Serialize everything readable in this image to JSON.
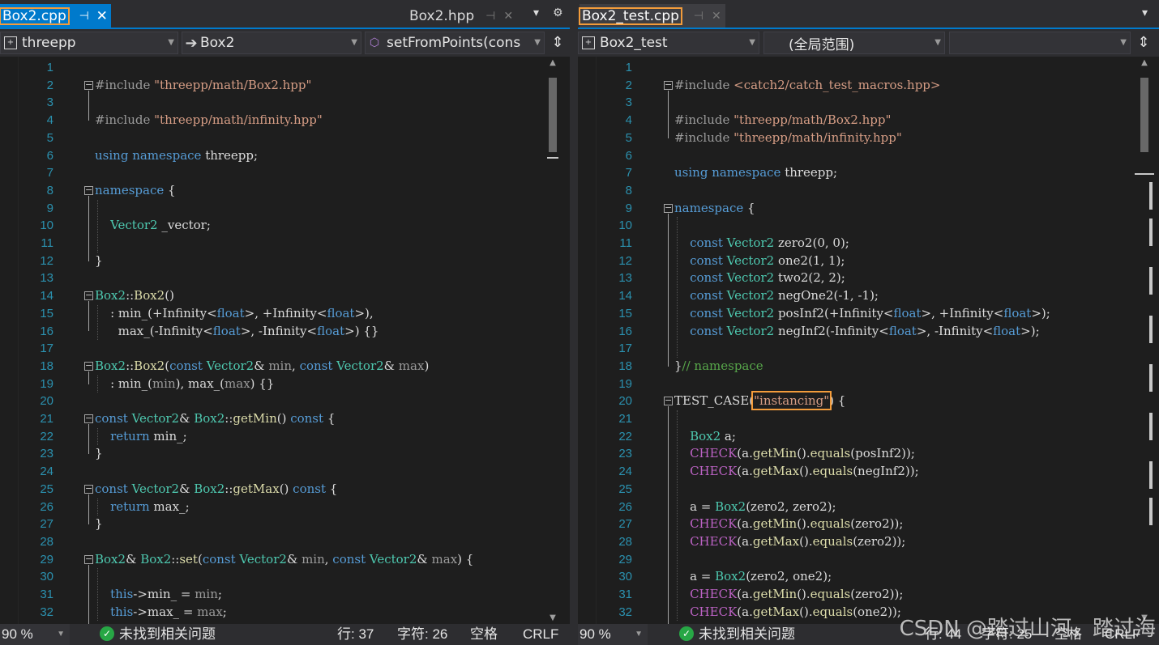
{
  "left": {
    "tabs": {
      "active_label": "Box2.cpp",
      "inactive_label": "Box2.hpp",
      "pin_glyph": "⊣",
      "close_glyph": "✕",
      "overflow_glyph": "▾",
      "settings_glyph": "⚙"
    },
    "nav": {
      "project": "threepp",
      "scope": "Box2",
      "member": "setFromPoints(cons"
    },
    "status": {
      "zoom": "90 %",
      "issues": "未找到相关问题",
      "line": "行: 37",
      "char": "字符: 26",
      "indent": "空格",
      "eol": "CRLF"
    }
  },
  "right": {
    "tabs": {
      "active_label": "Box2_test.cpp",
      "pin_glyph": "⊣",
      "close_glyph": "✕",
      "overflow_glyph": "▾"
    },
    "nav": {
      "project": "Box2_test",
      "scope": "(全局范围)",
      "member": ""
    },
    "status": {
      "zoom": "90 %",
      "issues": "未找到相关问题",
      "line": "行: 44",
      "char": "字符: 25",
      "indent": "空格",
      "eol": "CRLF"
    }
  },
  "left_code": [
    {
      "n": "1",
      "segs": []
    },
    {
      "n": "2",
      "segs": [
        [
          "pp",
          "#include "
        ],
        [
          "str",
          "\"threepp/math/Box2.hpp\""
        ]
      ]
    },
    {
      "n": "3",
      "segs": []
    },
    {
      "n": "4",
      "segs": [
        [
          "pp",
          "#include "
        ],
        [
          "str",
          "\"threepp/math/infinity.hpp\""
        ]
      ]
    },
    {
      "n": "5",
      "segs": []
    },
    {
      "n": "6",
      "segs": [
        [
          "kw",
          "using "
        ],
        [
          "kw",
          "namespace "
        ],
        [
          "txt",
          "threepp;"
        ]
      ]
    },
    {
      "n": "7",
      "segs": []
    },
    {
      "n": "8",
      "segs": [
        [
          "kw",
          "namespace "
        ],
        [
          "txt",
          "{"
        ]
      ]
    },
    {
      "n": "9",
      "segs": []
    },
    {
      "n": "10",
      "segs": [
        [
          "txt",
          "    "
        ],
        [
          "type",
          "Vector2 "
        ],
        [
          "txt",
          "_vector;"
        ]
      ]
    },
    {
      "n": "11",
      "segs": []
    },
    {
      "n": "12",
      "segs": [
        [
          "txt",
          "}"
        ]
      ]
    },
    {
      "n": "13",
      "segs": []
    },
    {
      "n": "14",
      "segs": [
        [
          "type",
          "Box2"
        ],
        [
          "txt",
          "::"
        ],
        [
          "fn",
          "Box2"
        ],
        [
          "txt",
          "()"
        ]
      ]
    },
    {
      "n": "15",
      "segs": [
        [
          "txt",
          "    : "
        ],
        [
          "mem",
          "min_"
        ],
        [
          "txt",
          "(+Infinity<"
        ],
        [
          "kw",
          "float"
        ],
        [
          "txt",
          ">, +Infinity<"
        ],
        [
          "kw",
          "float"
        ],
        [
          "txt",
          ">),"
        ]
      ]
    },
    {
      "n": "16",
      "segs": [
        [
          "txt",
          "      "
        ],
        [
          "mem",
          "max_"
        ],
        [
          "txt",
          "(-Infinity<"
        ],
        [
          "kw",
          "float"
        ],
        [
          "txt",
          ">, -Infinity<"
        ],
        [
          "kw",
          "float"
        ],
        [
          "txt",
          ">) {}"
        ]
      ]
    },
    {
      "n": "17",
      "segs": []
    },
    {
      "n": "18",
      "segs": [
        [
          "type",
          "Box2"
        ],
        [
          "txt",
          "::"
        ],
        [
          "fn",
          "Box2"
        ],
        [
          "txt",
          "("
        ],
        [
          "kw",
          "const "
        ],
        [
          "type",
          "Vector2"
        ],
        [
          "txt",
          "& "
        ],
        [
          "param",
          "min"
        ],
        [
          "txt",
          ", "
        ],
        [
          "kw",
          "const "
        ],
        [
          "type",
          "Vector2"
        ],
        [
          "txt",
          "& "
        ],
        [
          "param",
          "max"
        ],
        [
          "txt",
          ")"
        ]
      ]
    },
    {
      "n": "19",
      "segs": [
        [
          "txt",
          "    : "
        ],
        [
          "mem",
          "min_"
        ],
        [
          "txt",
          "("
        ],
        [
          "param",
          "min"
        ],
        [
          "txt",
          "), "
        ],
        [
          "mem",
          "max_"
        ],
        [
          "txt",
          "("
        ],
        [
          "param",
          "max"
        ],
        [
          "txt",
          ") {}"
        ]
      ]
    },
    {
      "n": "20",
      "segs": []
    },
    {
      "n": "21",
      "segs": [
        [
          "kw",
          "const "
        ],
        [
          "type",
          "Vector2"
        ],
        [
          "txt",
          "& "
        ],
        [
          "type",
          "Box2"
        ],
        [
          "txt",
          "::"
        ],
        [
          "fn",
          "getMin"
        ],
        [
          "txt",
          "() "
        ],
        [
          "kw",
          "const "
        ],
        [
          "txt",
          "{"
        ]
      ]
    },
    {
      "n": "22",
      "segs": [
        [
          "txt",
          "    "
        ],
        [
          "kw",
          "return "
        ],
        [
          "mem",
          "min_"
        ],
        [
          "txt",
          ";"
        ]
      ]
    },
    {
      "n": "23",
      "segs": [
        [
          "txt",
          "}"
        ]
      ]
    },
    {
      "n": "24",
      "segs": []
    },
    {
      "n": "25",
      "segs": [
        [
          "kw",
          "const "
        ],
        [
          "type",
          "Vector2"
        ],
        [
          "txt",
          "& "
        ],
        [
          "type",
          "Box2"
        ],
        [
          "txt",
          "::"
        ],
        [
          "fn",
          "getMax"
        ],
        [
          "txt",
          "() "
        ],
        [
          "kw",
          "const "
        ],
        [
          "txt",
          "{"
        ]
      ]
    },
    {
      "n": "26",
      "segs": [
        [
          "txt",
          "    "
        ],
        [
          "kw",
          "return "
        ],
        [
          "mem",
          "max_"
        ],
        [
          "txt",
          ";"
        ]
      ]
    },
    {
      "n": "27",
      "segs": [
        [
          "txt",
          "}"
        ]
      ]
    },
    {
      "n": "28",
      "segs": []
    },
    {
      "n": "29",
      "segs": [
        [
          "type",
          "Box2"
        ],
        [
          "txt",
          "& "
        ],
        [
          "type",
          "Box2"
        ],
        [
          "txt",
          "::"
        ],
        [
          "fn",
          "set"
        ],
        [
          "txt",
          "("
        ],
        [
          "kw",
          "const "
        ],
        [
          "type",
          "Vector2"
        ],
        [
          "txt",
          "& "
        ],
        [
          "param",
          "min"
        ],
        [
          "txt",
          ", "
        ],
        [
          "kw",
          "const "
        ],
        [
          "type",
          "Vector2"
        ],
        [
          "txt",
          "& "
        ],
        [
          "param",
          "max"
        ],
        [
          "txt",
          ") {"
        ]
      ]
    },
    {
      "n": "30",
      "segs": []
    },
    {
      "n": "31",
      "segs": [
        [
          "txt",
          "    "
        ],
        [
          "kw",
          "this"
        ],
        [
          "txt",
          "->"
        ],
        [
          "mem",
          "min_"
        ],
        [
          "txt",
          " = "
        ],
        [
          "param",
          "min"
        ],
        [
          "txt",
          ";"
        ]
      ]
    },
    {
      "n": "32",
      "segs": [
        [
          "txt",
          "    "
        ],
        [
          "kw",
          "this"
        ],
        [
          "txt",
          "->"
        ],
        [
          "mem",
          "max_"
        ],
        [
          "txt",
          " = "
        ],
        [
          "param",
          "max"
        ],
        [
          "txt",
          ";"
        ]
      ]
    }
  ],
  "right_code": [
    {
      "n": "1",
      "segs": []
    },
    {
      "n": "2",
      "segs": [
        [
          "pp",
          "#include "
        ],
        [
          "str",
          "<catch2/catch_test_macros.hpp>"
        ]
      ]
    },
    {
      "n": "3",
      "segs": []
    },
    {
      "n": "4",
      "segs": [
        [
          "pp",
          "#include "
        ],
        [
          "str",
          "\"threepp/math/Box2.hpp\""
        ]
      ]
    },
    {
      "n": "5",
      "segs": [
        [
          "pp",
          "#include "
        ],
        [
          "str",
          "\"threepp/math/infinity.hpp\""
        ]
      ]
    },
    {
      "n": "6",
      "segs": []
    },
    {
      "n": "7",
      "segs": [
        [
          "kw",
          "using "
        ],
        [
          "kw",
          "namespace "
        ],
        [
          "txt",
          "threepp;"
        ]
      ]
    },
    {
      "n": "8",
      "segs": []
    },
    {
      "n": "9",
      "segs": [
        [
          "kw",
          "namespace "
        ],
        [
          "txt",
          "{"
        ]
      ]
    },
    {
      "n": "10",
      "segs": []
    },
    {
      "n": "11",
      "segs": [
        [
          "txt",
          "    "
        ],
        [
          "kw",
          "const "
        ],
        [
          "type",
          "Vector2 "
        ],
        [
          "txt",
          "zero2(0, 0);"
        ]
      ]
    },
    {
      "n": "12",
      "segs": [
        [
          "txt",
          "    "
        ],
        [
          "kw",
          "const "
        ],
        [
          "type",
          "Vector2 "
        ],
        [
          "txt",
          "one2(1, 1);"
        ]
      ]
    },
    {
      "n": "13",
      "segs": [
        [
          "txt",
          "    "
        ],
        [
          "kw",
          "const "
        ],
        [
          "type",
          "Vector2 "
        ],
        [
          "txt",
          "two2(2, 2);"
        ]
      ]
    },
    {
      "n": "14",
      "segs": [
        [
          "txt",
          "    "
        ],
        [
          "kw",
          "const "
        ],
        [
          "type",
          "Vector2 "
        ],
        [
          "txt",
          "negOne2(-1, -1);"
        ]
      ]
    },
    {
      "n": "15",
      "segs": [
        [
          "txt",
          "    "
        ],
        [
          "kw",
          "const "
        ],
        [
          "type",
          "Vector2 "
        ],
        [
          "txt",
          "posInf2(+Infinity<"
        ],
        [
          "kw",
          "float"
        ],
        [
          "txt",
          ">, +Infinity<"
        ],
        [
          "kw",
          "float"
        ],
        [
          "txt",
          ">);"
        ]
      ]
    },
    {
      "n": "16",
      "segs": [
        [
          "txt",
          "    "
        ],
        [
          "kw",
          "const "
        ],
        [
          "type",
          "Vector2 "
        ],
        [
          "txt",
          "negInf2(-Infinity<"
        ],
        [
          "kw",
          "float"
        ],
        [
          "txt",
          ">, -Infinity<"
        ],
        [
          "kw",
          "float"
        ],
        [
          "txt",
          ">);"
        ]
      ]
    },
    {
      "n": "17",
      "segs": []
    },
    {
      "n": "18",
      "segs": [
        [
          "txt",
          "}"
        ],
        [
          "cmt",
          "// namespace"
        ]
      ]
    },
    {
      "n": "19",
      "segs": []
    },
    {
      "n": "20",
      "segs": [
        [
          "txt",
          "TEST_CASE("
        ],
        [
          "hlstr",
          "\"instancing\""
        ],
        [
          "txt",
          ") {"
        ]
      ]
    },
    {
      "n": "21",
      "segs": []
    },
    {
      "n": "22",
      "segs": [
        [
          "txt",
          "    "
        ],
        [
          "type",
          "Box2 "
        ],
        [
          "txt",
          "a;"
        ]
      ]
    },
    {
      "n": "23",
      "segs": [
        [
          "txt",
          "    "
        ],
        [
          "macro",
          "CHECK"
        ],
        [
          "txt",
          "(a."
        ],
        [
          "fn",
          "getMin"
        ],
        [
          "txt",
          "()."
        ],
        [
          "fn",
          "equals"
        ],
        [
          "txt",
          "(posInf2));"
        ]
      ]
    },
    {
      "n": "24",
      "segs": [
        [
          "txt",
          "    "
        ],
        [
          "macro",
          "CHECK"
        ],
        [
          "txt",
          "(a."
        ],
        [
          "fn",
          "getMax"
        ],
        [
          "txt",
          "()."
        ],
        [
          "fn",
          "equals"
        ],
        [
          "txt",
          "(negInf2));"
        ]
      ]
    },
    {
      "n": "25",
      "segs": []
    },
    {
      "n": "26",
      "segs": [
        [
          "txt",
          "    a = "
        ],
        [
          "type",
          "Box2"
        ],
        [
          "txt",
          "(zero2, zero2);"
        ]
      ]
    },
    {
      "n": "27",
      "segs": [
        [
          "txt",
          "    "
        ],
        [
          "macro",
          "CHECK"
        ],
        [
          "txt",
          "(a."
        ],
        [
          "fn",
          "getMin"
        ],
        [
          "txt",
          "()."
        ],
        [
          "fn",
          "equals"
        ],
        [
          "txt",
          "(zero2));"
        ]
      ]
    },
    {
      "n": "28",
      "segs": [
        [
          "txt",
          "    "
        ],
        [
          "macro",
          "CHECK"
        ],
        [
          "txt",
          "(a."
        ],
        [
          "fn",
          "getMax"
        ],
        [
          "txt",
          "()."
        ],
        [
          "fn",
          "equals"
        ],
        [
          "txt",
          "(zero2));"
        ]
      ]
    },
    {
      "n": "29",
      "segs": []
    },
    {
      "n": "30",
      "segs": [
        [
          "txt",
          "    a = "
        ],
        [
          "type",
          "Box2"
        ],
        [
          "txt",
          "(zero2, one2);"
        ]
      ]
    },
    {
      "n": "31",
      "segs": [
        [
          "txt",
          "    "
        ],
        [
          "macro",
          "CHECK"
        ],
        [
          "txt",
          "(a."
        ],
        [
          "fn",
          "getMin"
        ],
        [
          "txt",
          "()."
        ],
        [
          "fn",
          "equals"
        ],
        [
          "txt",
          "(zero2));"
        ]
      ]
    },
    {
      "n": "32",
      "segs": [
        [
          "txt",
          "    "
        ],
        [
          "macro",
          "CHECK"
        ],
        [
          "txt",
          "(a."
        ],
        [
          "fn",
          "getMax"
        ],
        [
          "txt",
          "()."
        ],
        [
          "fn",
          "equals"
        ],
        [
          "txt",
          "(one2));"
        ]
      ]
    }
  ],
  "watermark": "CSDN @踏过山河，踏过海",
  "colors": {
    "accent": "#007acc",
    "highlight_outline": "#f39c3b",
    "line_number": "#2b91af",
    "keyword": "#569cd6",
    "type": "#4ec9b0",
    "string": "#d69d85",
    "comment": "#57a64a"
  }
}
